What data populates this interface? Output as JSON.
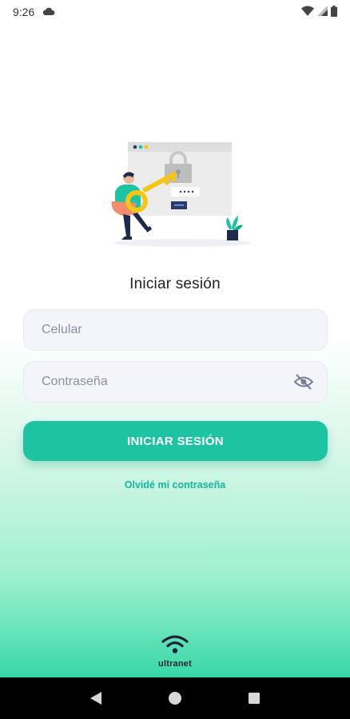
{
  "status_bar": {
    "time": "9:26",
    "icons": [
      "cloud-icon",
      "wifi-icon",
      "signal-icon",
      "battery-icon"
    ]
  },
  "login": {
    "title": "Iniciar sesión",
    "phone_placeholder": "Celular",
    "password_placeholder": "Contraseña",
    "submit_label": "INICIAR SESIÓN",
    "forgot_label": "Olvidé mi contraseña"
  },
  "brand": {
    "name": "ultranet",
    "icon": "wifi-logo-icon"
  },
  "nav": {
    "icons": [
      "back-icon",
      "home-icon",
      "recents-icon"
    ]
  },
  "colors": {
    "accent": "#1ec3a3",
    "link": "#14b89a",
    "gradient_bottom": "#34d3a6"
  }
}
